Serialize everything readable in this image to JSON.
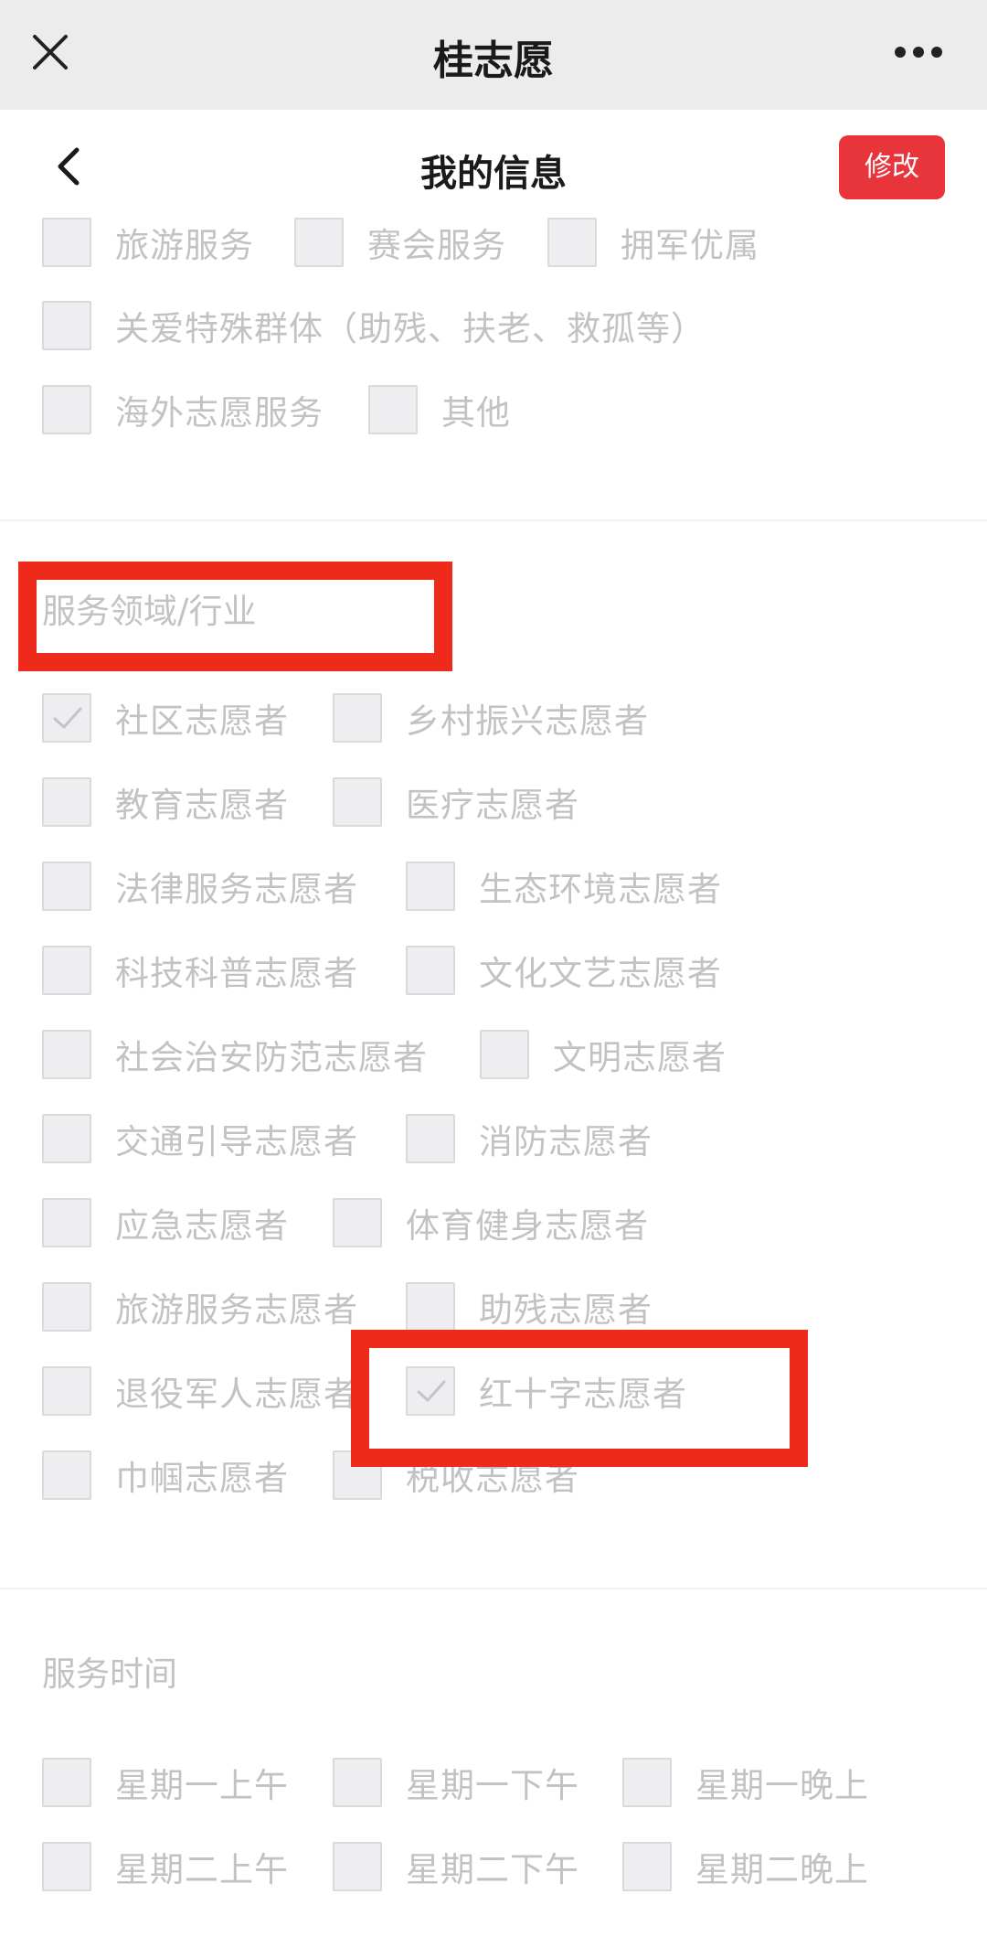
{
  "app": {
    "title": "桂志愿",
    "close_icon": "close-icon",
    "more_icon": "more-icon"
  },
  "header": {
    "title": "我的信息",
    "edit_label": "修改",
    "back_icon": "chevron-left-icon"
  },
  "colors": {
    "accent": "#e8343b",
    "highlight": "#ee2a1a",
    "muted_text": "#c2c2c4"
  },
  "service_content": {
    "items": [
      {
        "label": "旅游服务",
        "checked": false
      },
      {
        "label": "赛会服务",
        "checked": false
      },
      {
        "label": "拥军优属",
        "checked": false
      },
      {
        "label": "关爱特殊群体（助残、扶老、救孤等）",
        "checked": false
      },
      {
        "label": "海外志愿服务",
        "checked": false
      },
      {
        "label": "其他",
        "checked": false
      }
    ]
  },
  "service_field": {
    "title": "服务领域/行业",
    "items": [
      {
        "label": "社区志愿者",
        "checked": true
      },
      {
        "label": "乡村振兴志愿者",
        "checked": false
      },
      {
        "label": "教育志愿者",
        "checked": false
      },
      {
        "label": "医疗志愿者",
        "checked": false
      },
      {
        "label": "法律服务志愿者",
        "checked": false
      },
      {
        "label": "生态环境志愿者",
        "checked": false
      },
      {
        "label": "科技科普志愿者",
        "checked": false
      },
      {
        "label": "文化文艺志愿者",
        "checked": false
      },
      {
        "label": "社会治安防范志愿者",
        "checked": false
      },
      {
        "label": "文明志愿者",
        "checked": false
      },
      {
        "label": "交通引导志愿者",
        "checked": false
      },
      {
        "label": "消防志愿者",
        "checked": false
      },
      {
        "label": "应急志愿者",
        "checked": false
      },
      {
        "label": "体育健身志愿者",
        "checked": false
      },
      {
        "label": "旅游服务志愿者",
        "checked": false
      },
      {
        "label": "助残志愿者",
        "checked": false
      },
      {
        "label": "退役军人志愿者",
        "checked": false
      },
      {
        "label": "红十字志愿者",
        "checked": true
      },
      {
        "label": "巾帼志愿者",
        "checked": false
      },
      {
        "label": "税收志愿者",
        "checked": false
      }
    ]
  },
  "service_time": {
    "title": "服务时间",
    "items": [
      {
        "label": "星期一上午",
        "checked": false
      },
      {
        "label": "星期一下午",
        "checked": false
      },
      {
        "label": "星期一晚上",
        "checked": false
      },
      {
        "label": "星期二上午",
        "checked": false
      },
      {
        "label": "星期二下午",
        "checked": false
      },
      {
        "label": "星期二晚上",
        "checked": false
      }
    ]
  }
}
